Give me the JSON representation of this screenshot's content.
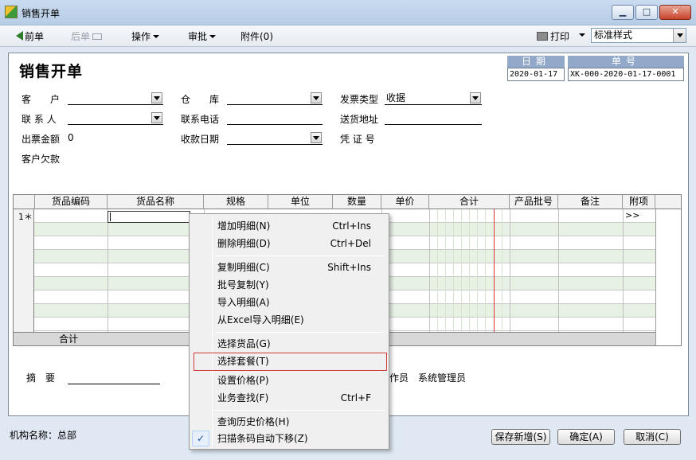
{
  "window": {
    "title": "销售开单",
    "min": "▁",
    "max": "□",
    "close": "✕"
  },
  "toolbar": {
    "prev": "前单",
    "next": "后单",
    "operate": "操作",
    "approve": "审批",
    "attach": "附件(0)",
    "print": "打印",
    "print_style": "标准样式"
  },
  "doc": {
    "title": "销售开单",
    "date_caption": "日期",
    "date_value": "2020-01-17",
    "no_caption": "单号",
    "no_value": "XK-000-2020-01-17-0001"
  },
  "form": {
    "customer": "客　　户",
    "contact": "联 系 人",
    "invoice_amount": "出票金额",
    "invoice_amount_value": "0",
    "customer_debt": "客户欠款",
    "warehouse": "仓　　库",
    "phone": "联系电话",
    "receive_date": "收款日期",
    "invoice_type": "发票类型",
    "invoice_type_value": "收据",
    "ship_addr": "送货地址",
    "voucher_no": "凭 证 号",
    "memo": "摘　要",
    "operator_label": "作员",
    "operator_value": "系统管理员"
  },
  "grid": {
    "columns": [
      "货品编码",
      "货品名称",
      "规格",
      "单位",
      "数量",
      "单价",
      "合计",
      "产品批号",
      "备注",
      "附项"
    ],
    "row1_marker": "1＊",
    "row1_extra": ">>",
    "total_label": "合计"
  },
  "menu": {
    "items": [
      {
        "label": "增加明细(N)",
        "key": "Ctrl+Ins"
      },
      {
        "label": "删除明细(D)",
        "key": "Ctrl+Del"
      },
      {
        "label": "复制明细(C)",
        "key": "Shift+Ins"
      },
      {
        "label": "批号复制(Y)",
        "key": ""
      },
      {
        "label": "导入明细(A)",
        "key": ""
      },
      {
        "label": "从Excel导入明细(E)",
        "key": ""
      },
      {
        "label": "选择货品(G)",
        "key": ""
      },
      {
        "label": "选择套餐(T)",
        "key": ""
      },
      {
        "label": "设置价格(P)",
        "key": ""
      },
      {
        "label": "业务查找(F)",
        "key": "Ctrl+F"
      },
      {
        "label": "查询历史价格(H)",
        "key": ""
      },
      {
        "label": "扫描条码自动下移(Z)",
        "key": ""
      }
    ],
    "check_mark": "✓"
  },
  "footer": {
    "org_label": "机构名称：",
    "org_value": "总部",
    "save_new": "保存新增(S)",
    "confirm": "确定(A)",
    "cancel": "取消(C)"
  }
}
